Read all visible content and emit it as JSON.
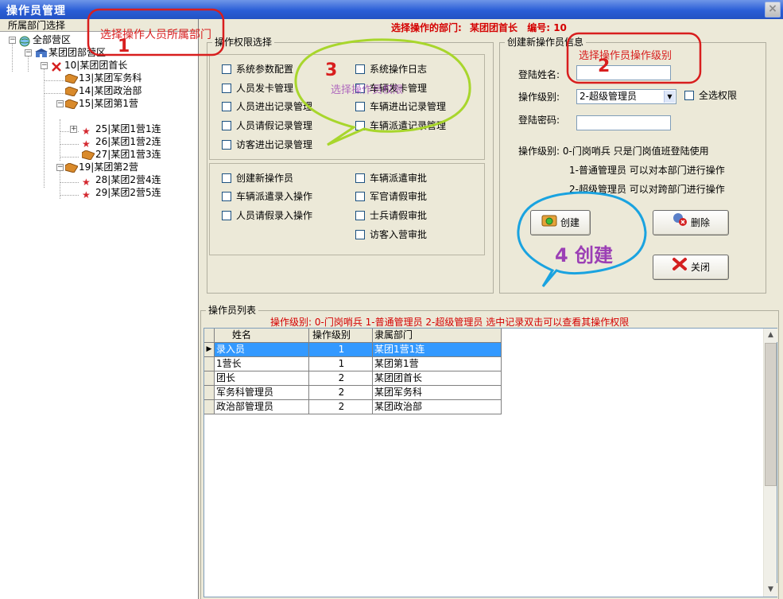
{
  "window": {
    "title": "操作员管理",
    "close_label": "×"
  },
  "header": {
    "dept_label": "选择操作的部门:",
    "dept_value": "某团团首长",
    "code_label": "编号:",
    "code_value": "10"
  },
  "left": {
    "caption": "所属部门选择",
    "tree": [
      {
        "label": "全部营区",
        "icon": "globe-icon"
      },
      {
        "label": "某团团部营区",
        "icon": "building-icon"
      },
      {
        "label": "10|某团团首长",
        "icon": "cross-icon"
      },
      {
        "label": "13|某团军务科",
        "icon": "folder-icon"
      },
      {
        "label": "14|某团政治部",
        "icon": "folder-icon"
      },
      {
        "label": "15|某团第1营",
        "icon": "folder-icon"
      },
      {
        "label": "25|某团1营1连",
        "icon": "star-icon"
      },
      {
        "label": "26|某团1营2连",
        "icon": "star-icon"
      },
      {
        "label": "27|某团1营3连",
        "icon": "folder-icon"
      },
      {
        "label": "19|某团第2营",
        "icon": "folder-icon"
      },
      {
        "label": "28|某团2营4连",
        "icon": "star-icon"
      },
      {
        "label": "29|某团2营5连",
        "icon": "star-icon"
      }
    ]
  },
  "perms": {
    "legend": "操作权限选择",
    "group1": [
      "系统参数配置",
      "系统操作日志",
      "人员发卡管理",
      "车辆发卡管理",
      "人员进出记录管理",
      "车辆进出记录管理",
      "人员请假记录管理",
      "车辆派遣记录管理",
      "访客进出记录管理"
    ],
    "group2": [
      "创建新操作员",
      "车辆派遣审批",
      "车辆派遣录入操作",
      "军官请假审批",
      "人员请假录入操作",
      "士兵请假审批",
      "访客入营审批"
    ]
  },
  "create": {
    "legend": "创建新操作员信息",
    "login_name_label": "登陆姓名:",
    "login_name_value": "",
    "level_label": "操作级别:",
    "level_value": "2-超级管理员",
    "all_perms_label": "全选权限",
    "password_label": "登陆密码:",
    "password_value": "",
    "level_desc": [
      "操作级别: 0-门岗哨兵   只是门岗值班登陆使用",
      "1-普通管理员   可以对本部门进行操作",
      "2-超级管理员   可以对跨部门进行操作"
    ],
    "btn_create": "创建",
    "btn_delete": "删除",
    "btn_close": "关闭"
  },
  "list": {
    "legend": "操作员列表",
    "hint": "操作级别: 0-门岗哨兵     1-普通管理员     2-超级管理员   选中记录双击可以查看其操作权限",
    "columns": [
      "姓名",
      "操作级别",
      "隶属部门"
    ],
    "rows": [
      [
        "录入员",
        "1",
        "某团1营1连"
      ],
      [
        "1营长",
        "1",
        "某团第1营"
      ],
      [
        "团长",
        "2",
        "某团团首长"
      ],
      [
        "军务科管理员",
        "2",
        "某团军务科"
      ],
      [
        "政治部管理员",
        "2",
        "某团政治部"
      ]
    ]
  },
  "annotations": {
    "a1_text": "选择操作人员所属部门",
    "a1_num": "1",
    "a2_text": "选择操作员操作级别",
    "a2_num": "2",
    "a3_num": "3",
    "a3_text": "选择操作员权限",
    "a4_text": "4 创建",
    "colors": {
      "red": "#d81e1e",
      "green": "#a8d62c",
      "blue": "#1aa3e0",
      "purple": "#9b3fb5"
    }
  }
}
